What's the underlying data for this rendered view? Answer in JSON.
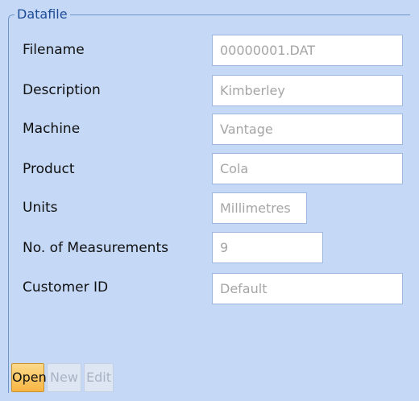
{
  "group": {
    "title": "Datafile"
  },
  "fields": [
    {
      "label": "Filename",
      "value": "00000001.DAT"
    },
    {
      "label": "Description",
      "value": "Kimberley"
    },
    {
      "label": "Machine",
      "value": "Vantage"
    },
    {
      "label": "Product",
      "value": "Cola"
    },
    {
      "label": "Units",
      "value": "Millimetres"
    },
    {
      "label": "No. of Measurements",
      "value": "9"
    },
    {
      "label": "Customer ID",
      "value": "Default"
    }
  ],
  "buttons": {
    "open": "Open",
    "new": "New",
    "edit": "Edit"
  }
}
